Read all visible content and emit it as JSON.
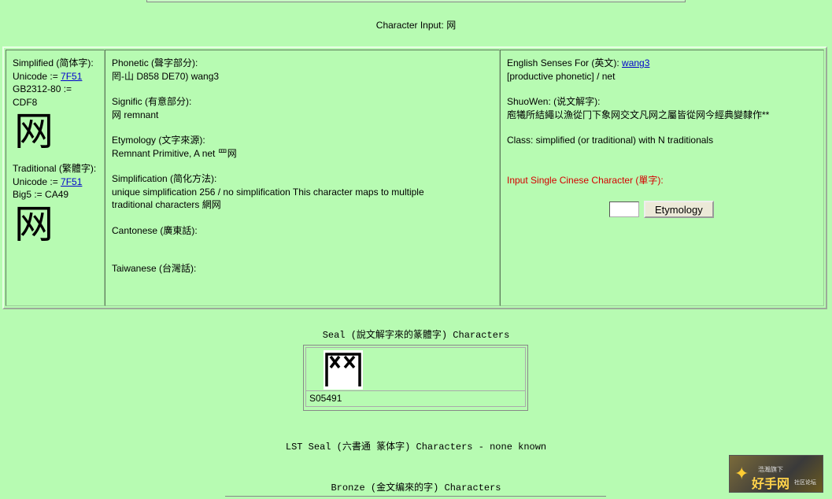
{
  "header": {
    "char_input_label": "Character Input: ",
    "char_input_value": "网"
  },
  "col1": {
    "simplified_label": "Simplified (简体字):",
    "simplified_unicode_label": "Unicode := ",
    "simplified_unicode_link": "7F51",
    "simplified_gb_label": "GB2312-80 := CDF8",
    "simplified_char": "网",
    "traditional_label": "Traditional (繁體字):",
    "traditional_unicode_label": "Unicode := ",
    "traditional_unicode_link": "7F51",
    "traditional_big5_label": "Big5 := CA49",
    "traditional_char": "网"
  },
  "col2": {
    "phonetic_label": "Phonetic (聲字部分):",
    "phonetic_value": "罔-山  D858 DE70) wang3",
    "signific_label": "Signific (有意部分):",
    "signific_value": "网  remnant",
    "etymology_label": "Etymology (文字來源):",
    "etymology_value": "Remnant Primitive, A net 罒网",
    "simplification_label": "Simplification (简化方法):",
    "simplification_value": "unique simplification 256 / no simplification This character maps to multiple traditional characters 網网",
    "cantonese_label": "Cantonese (廣東話):",
    "taiwanese_label": "Taiwanese (台灣話):"
  },
  "col3": {
    "english_label": "English Senses For (英文): ",
    "english_link": "wang3",
    "english_value": "[productive phonetic] / net",
    "shuowen_label": "ShuoWen: (说文解字):",
    "shuowen_value": "庖犧所結繩以漁從冂下象网交文凡网之屬皆從网今經典變隸作**",
    "class_value": "Class: simplified (or traditional) with N traditionals",
    "input_prompt": "Input Single Cinese Character (單字):",
    "etymology_button": "Etymology",
    "input_value": ""
  },
  "seal": {
    "title": "Seal (說文解字來的篆體字) Characters",
    "id": "S05491"
  },
  "lst": {
    "title": "LST Seal (六書通 篆体字) Characters - none known"
  },
  "bronze": {
    "title": "Bronze (金文编來的字) Characters"
  },
  "watermark": {
    "small": "浩瀚旗下",
    "big": "好手网",
    "tag": "社区论坛"
  }
}
